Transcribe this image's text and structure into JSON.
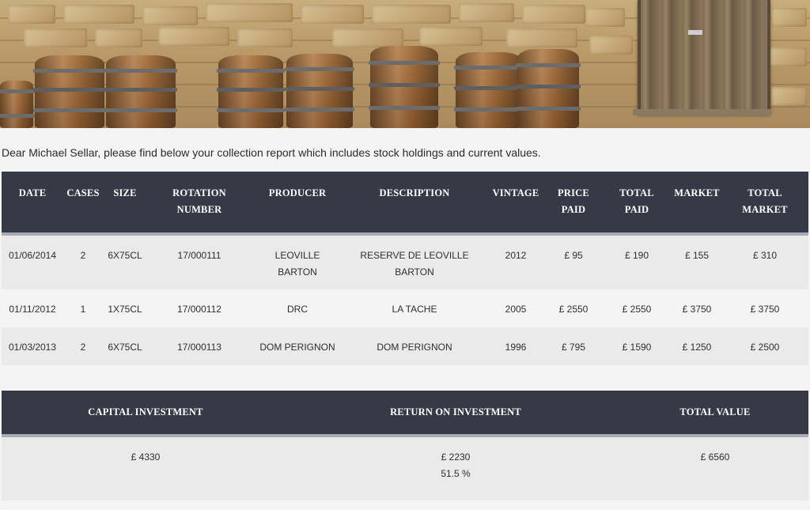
{
  "hero": {
    "image": "wine-barrels-stone-wall-photo"
  },
  "greeting": "Dear Michael Sellar, please find below your collection report which includes stock holdings and current values.",
  "stock_table": {
    "headers": [
      [
        "DATE"
      ],
      [
        "CASES"
      ],
      [
        "SIZE"
      ],
      [
        "ROTATION",
        "NUMBER"
      ],
      [
        "PRODUCER"
      ],
      [
        "DESCRIPTION"
      ],
      [
        "VINTAGE"
      ],
      [
        "PRICE",
        "PAID"
      ],
      [
        "TOTAL",
        "PAID"
      ],
      [
        "MARKET"
      ],
      [
        "TOTAL",
        "MARKET"
      ]
    ],
    "rows": [
      {
        "date": "01/06/2014",
        "cases": "2",
        "size": "6X75CL",
        "rotation": "17/000111",
        "producer": [
          "LEOVILLE",
          "BARTON"
        ],
        "description": [
          "RESERVE DE LEOVILLE",
          "BARTON"
        ],
        "vintage": "2012",
        "price_paid": "£ 95",
        "total_paid": "£ 190",
        "market": "£ 155",
        "total_market": "£ 310"
      },
      {
        "date": "01/11/2012",
        "cases": "1",
        "size": "1X75CL",
        "rotation": "17/000112",
        "producer": [
          "DRC"
        ],
        "description": [
          "LA TACHE"
        ],
        "vintage": "2005",
        "price_paid": "£ 2550",
        "total_paid": "£ 2550",
        "market": "£ 3750",
        "total_market": "£ 3750"
      },
      {
        "date": "01/03/2013",
        "cases": "2",
        "size": "6X75CL",
        "rotation": "17/000113",
        "producer": [
          "DOM PERIGNON"
        ],
        "description": [
          "DOM PERIGNON"
        ],
        "vintage": "1996",
        "price_paid": "£ 795",
        "total_paid": "£ 1590",
        "market": "£ 1250",
        "total_market": "£ 2500"
      }
    ]
  },
  "summary_table": {
    "headers": [
      "CAPITAL INVESTMENT",
      "RETURN ON INVESTMENT",
      "TOTAL VALUE"
    ],
    "capital_investment": "£ 4330",
    "return_on_investment": "£ 2230",
    "return_percent": "51.5 %",
    "total_value": "£ 6560"
  },
  "colors": {
    "header_bg": "#363a47",
    "header_separator": "#a7adb5",
    "row_alt": "#eaeaea",
    "page_bg": "#f4f4f4"
  }
}
